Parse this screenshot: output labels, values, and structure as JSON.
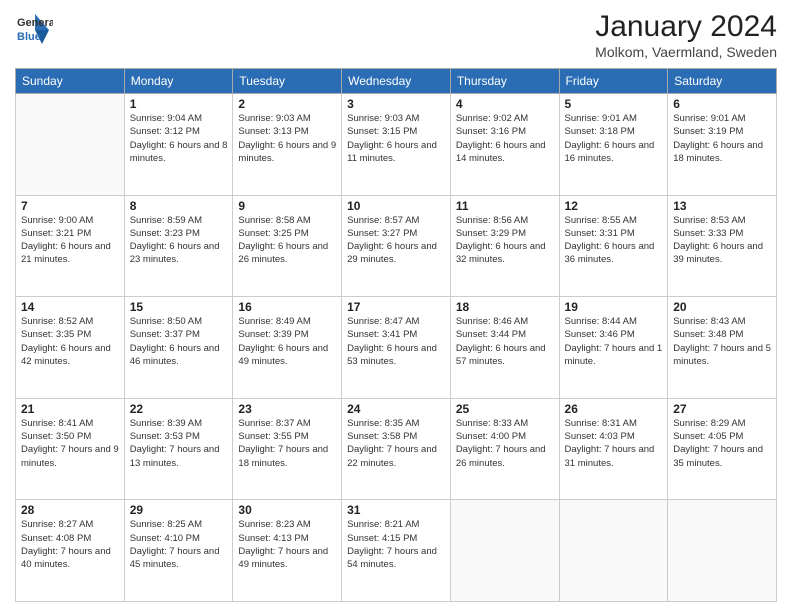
{
  "logo": {
    "general": "General",
    "blue": "Blue"
  },
  "title": "January 2024",
  "location": "Molkom, Vaermland, Sweden",
  "days_header": [
    "Sunday",
    "Monday",
    "Tuesday",
    "Wednesday",
    "Thursday",
    "Friday",
    "Saturday"
  ],
  "weeks": [
    [
      {
        "day": "",
        "sunrise": "",
        "sunset": "",
        "daylight": ""
      },
      {
        "day": "1",
        "sunrise": "Sunrise: 9:04 AM",
        "sunset": "Sunset: 3:12 PM",
        "daylight": "Daylight: 6 hours and 8 minutes."
      },
      {
        "day": "2",
        "sunrise": "Sunrise: 9:03 AM",
        "sunset": "Sunset: 3:13 PM",
        "daylight": "Daylight: 6 hours and 9 minutes."
      },
      {
        "day": "3",
        "sunrise": "Sunrise: 9:03 AM",
        "sunset": "Sunset: 3:15 PM",
        "daylight": "Daylight: 6 hours and 11 minutes."
      },
      {
        "day": "4",
        "sunrise": "Sunrise: 9:02 AM",
        "sunset": "Sunset: 3:16 PM",
        "daylight": "Daylight: 6 hours and 14 minutes."
      },
      {
        "day": "5",
        "sunrise": "Sunrise: 9:01 AM",
        "sunset": "Sunset: 3:18 PM",
        "daylight": "Daylight: 6 hours and 16 minutes."
      },
      {
        "day": "6",
        "sunrise": "Sunrise: 9:01 AM",
        "sunset": "Sunset: 3:19 PM",
        "daylight": "Daylight: 6 hours and 18 minutes."
      }
    ],
    [
      {
        "day": "7",
        "sunrise": "Sunrise: 9:00 AM",
        "sunset": "Sunset: 3:21 PM",
        "daylight": "Daylight: 6 hours and 21 minutes."
      },
      {
        "day": "8",
        "sunrise": "Sunrise: 8:59 AM",
        "sunset": "Sunset: 3:23 PM",
        "daylight": "Daylight: 6 hours and 23 minutes."
      },
      {
        "day": "9",
        "sunrise": "Sunrise: 8:58 AM",
        "sunset": "Sunset: 3:25 PM",
        "daylight": "Daylight: 6 hours and 26 minutes."
      },
      {
        "day": "10",
        "sunrise": "Sunrise: 8:57 AM",
        "sunset": "Sunset: 3:27 PM",
        "daylight": "Daylight: 6 hours and 29 minutes."
      },
      {
        "day": "11",
        "sunrise": "Sunrise: 8:56 AM",
        "sunset": "Sunset: 3:29 PM",
        "daylight": "Daylight: 6 hours and 32 minutes."
      },
      {
        "day": "12",
        "sunrise": "Sunrise: 8:55 AM",
        "sunset": "Sunset: 3:31 PM",
        "daylight": "Daylight: 6 hours and 36 minutes."
      },
      {
        "day": "13",
        "sunrise": "Sunrise: 8:53 AM",
        "sunset": "Sunset: 3:33 PM",
        "daylight": "Daylight: 6 hours and 39 minutes."
      }
    ],
    [
      {
        "day": "14",
        "sunrise": "Sunrise: 8:52 AM",
        "sunset": "Sunset: 3:35 PM",
        "daylight": "Daylight: 6 hours and 42 minutes."
      },
      {
        "day": "15",
        "sunrise": "Sunrise: 8:50 AM",
        "sunset": "Sunset: 3:37 PM",
        "daylight": "Daylight: 6 hours and 46 minutes."
      },
      {
        "day": "16",
        "sunrise": "Sunrise: 8:49 AM",
        "sunset": "Sunset: 3:39 PM",
        "daylight": "Daylight: 6 hours and 49 minutes."
      },
      {
        "day": "17",
        "sunrise": "Sunrise: 8:47 AM",
        "sunset": "Sunset: 3:41 PM",
        "daylight": "Daylight: 6 hours and 53 minutes."
      },
      {
        "day": "18",
        "sunrise": "Sunrise: 8:46 AM",
        "sunset": "Sunset: 3:44 PM",
        "daylight": "Daylight: 6 hours and 57 minutes."
      },
      {
        "day": "19",
        "sunrise": "Sunrise: 8:44 AM",
        "sunset": "Sunset: 3:46 PM",
        "daylight": "Daylight: 7 hours and 1 minute."
      },
      {
        "day": "20",
        "sunrise": "Sunrise: 8:43 AM",
        "sunset": "Sunset: 3:48 PM",
        "daylight": "Daylight: 7 hours and 5 minutes."
      }
    ],
    [
      {
        "day": "21",
        "sunrise": "Sunrise: 8:41 AM",
        "sunset": "Sunset: 3:50 PM",
        "daylight": "Daylight: 7 hours and 9 minutes."
      },
      {
        "day": "22",
        "sunrise": "Sunrise: 8:39 AM",
        "sunset": "Sunset: 3:53 PM",
        "daylight": "Daylight: 7 hours and 13 minutes."
      },
      {
        "day": "23",
        "sunrise": "Sunrise: 8:37 AM",
        "sunset": "Sunset: 3:55 PM",
        "daylight": "Daylight: 7 hours and 18 minutes."
      },
      {
        "day": "24",
        "sunrise": "Sunrise: 8:35 AM",
        "sunset": "Sunset: 3:58 PM",
        "daylight": "Daylight: 7 hours and 22 minutes."
      },
      {
        "day": "25",
        "sunrise": "Sunrise: 8:33 AM",
        "sunset": "Sunset: 4:00 PM",
        "daylight": "Daylight: 7 hours and 26 minutes."
      },
      {
        "day": "26",
        "sunrise": "Sunrise: 8:31 AM",
        "sunset": "Sunset: 4:03 PM",
        "daylight": "Daylight: 7 hours and 31 minutes."
      },
      {
        "day": "27",
        "sunrise": "Sunrise: 8:29 AM",
        "sunset": "Sunset: 4:05 PM",
        "daylight": "Daylight: 7 hours and 35 minutes."
      }
    ],
    [
      {
        "day": "28",
        "sunrise": "Sunrise: 8:27 AM",
        "sunset": "Sunset: 4:08 PM",
        "daylight": "Daylight: 7 hours and 40 minutes."
      },
      {
        "day": "29",
        "sunrise": "Sunrise: 8:25 AM",
        "sunset": "Sunset: 4:10 PM",
        "daylight": "Daylight: 7 hours and 45 minutes."
      },
      {
        "day": "30",
        "sunrise": "Sunrise: 8:23 AM",
        "sunset": "Sunset: 4:13 PM",
        "daylight": "Daylight: 7 hours and 49 minutes."
      },
      {
        "day": "31",
        "sunrise": "Sunrise: 8:21 AM",
        "sunset": "Sunset: 4:15 PM",
        "daylight": "Daylight: 7 hours and 54 minutes."
      },
      {
        "day": "",
        "sunrise": "",
        "sunset": "",
        "daylight": ""
      },
      {
        "day": "",
        "sunrise": "",
        "sunset": "",
        "daylight": ""
      },
      {
        "day": "",
        "sunrise": "",
        "sunset": "",
        "daylight": ""
      }
    ]
  ]
}
